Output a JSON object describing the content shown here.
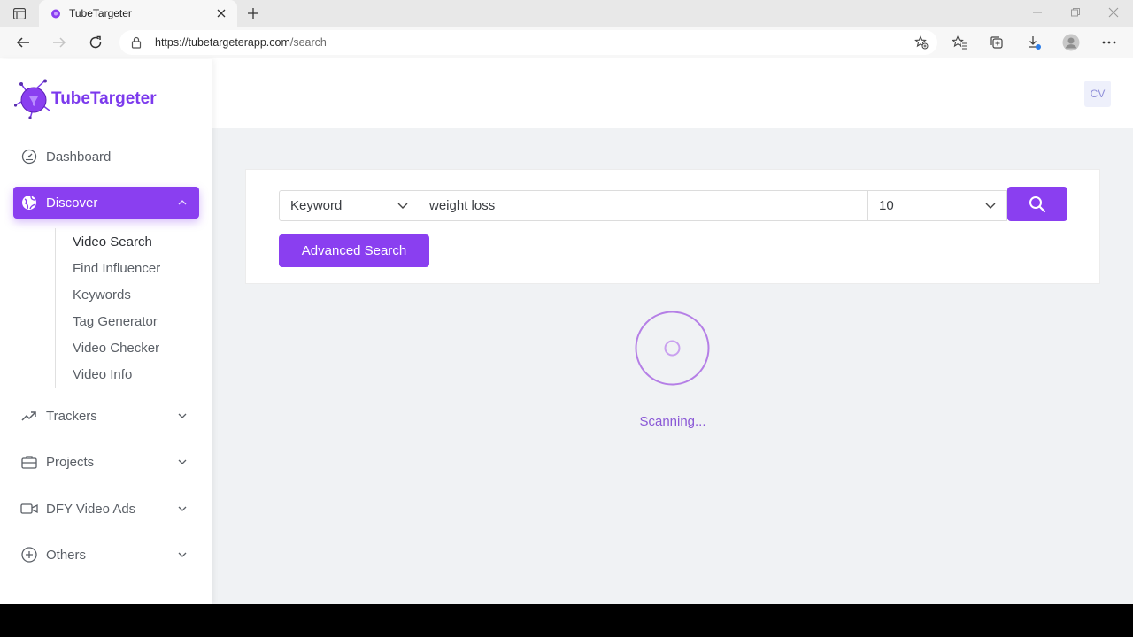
{
  "browser": {
    "tab_title": "TubeTargeter",
    "url_host": "https://tubetargeterapp.com",
    "url_path": "/search"
  },
  "app": {
    "logo_text": "TubeTargeter",
    "avatar_initials": "CV",
    "brand_color": "#8a3ff0"
  },
  "sidebar": {
    "dashboard": "Dashboard",
    "discover": "Discover",
    "discover_sub": [
      "Video Search",
      "Find Influencer",
      "Keywords",
      "Tag Generator",
      "Video Checker",
      "Video Info"
    ],
    "trackers": "Trackers",
    "projects": "Projects",
    "dfy_video_ads": "DFY Video Ads",
    "others": "Others"
  },
  "search": {
    "type_value": "Keyword",
    "query_value": "weight loss",
    "count_value": "10",
    "advanced_label": "Advanced Search"
  },
  "status": {
    "scanning_text": "Scanning..."
  }
}
